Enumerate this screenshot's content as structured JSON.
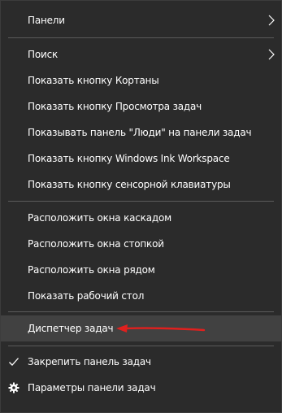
{
  "menu": {
    "items": [
      {
        "label": "Панели"
      },
      {
        "label": "Поиск"
      },
      {
        "label": "Показать кнопку Кортаны"
      },
      {
        "label": "Показать кнопку Просмотра задач"
      },
      {
        "label": "Показывать панель \"Люди\" на панели задач"
      },
      {
        "label": "Показать кнопку Windows Ink Workspace"
      },
      {
        "label": "Показать кнопку сенсорной клавиатуры"
      },
      {
        "label": "Расположить окна каскадом"
      },
      {
        "label": "Расположить окна стопкой"
      },
      {
        "label": "Расположить окна рядом"
      },
      {
        "label": "Показать рабочий стол"
      },
      {
        "label": "Диспетчер задач"
      },
      {
        "label": "Закрепить панель задач"
      },
      {
        "label": "Параметры панели задач"
      }
    ]
  },
  "icons": {
    "submenu": "chevron-right-icon",
    "pinned_check": "checkmark-icon",
    "settings": "gear-icon"
  },
  "colors": {
    "background": "#2b2b2b",
    "highlight": "#414141",
    "separator": "#5a5a5a",
    "text": "#ffffff",
    "annotation": "#e0201e"
  }
}
